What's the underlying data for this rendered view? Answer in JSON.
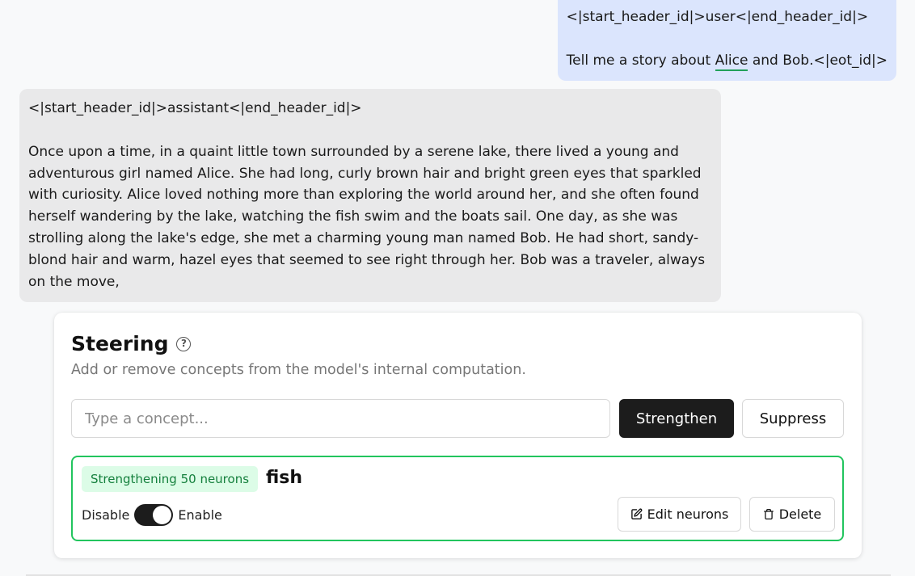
{
  "user_message": {
    "header": "<|start_header_id|>user<|end_header_id|>",
    "text_before": "Tell me a story about ",
    "highlighted_word": "Alice",
    "text_after": " and Bob.<|eot_id|>"
  },
  "assistant_message": {
    "header": "<|start_header_id|>assistant<|end_header_id|>",
    "body": "Once upon a time, in a quaint little town surrounded by a serene lake, there lived a young and adventurous girl named Alice. She had long, curly brown hair and bright green eyes that sparkled with curiosity. Alice loved nothing more than exploring the world around her, and she often found herself wandering by the lake, watching the fish swim and the boats sail. One day, as she was strolling along the lake's edge, she met a charming young man named Bob. He had short, sandy-blond hair and warm, hazel eyes that seemed to see right through her. Bob was a traveler, always on the move,"
  },
  "steering": {
    "title": "Steering",
    "subtitle": "Add or remove concepts from the model's internal computation.",
    "input_placeholder": "Type a concept...",
    "strengthen_label": "Strengthen",
    "suppress_label": "Suppress",
    "concept": {
      "badge": "Strengthening 50 neurons",
      "name": "fish",
      "disable_label": "Disable",
      "enable_label": "Enable",
      "enabled": true,
      "edit_label": "Edit neurons",
      "delete_label": "Delete"
    }
  },
  "colors": {
    "user_bubble": "#dbe5fd",
    "assistant_bubble": "#e9e9ea",
    "accent_green": "#22c55e",
    "badge_bg": "#dcfce7",
    "badge_text": "#15803d",
    "dark_button": "#1c1c1c"
  }
}
